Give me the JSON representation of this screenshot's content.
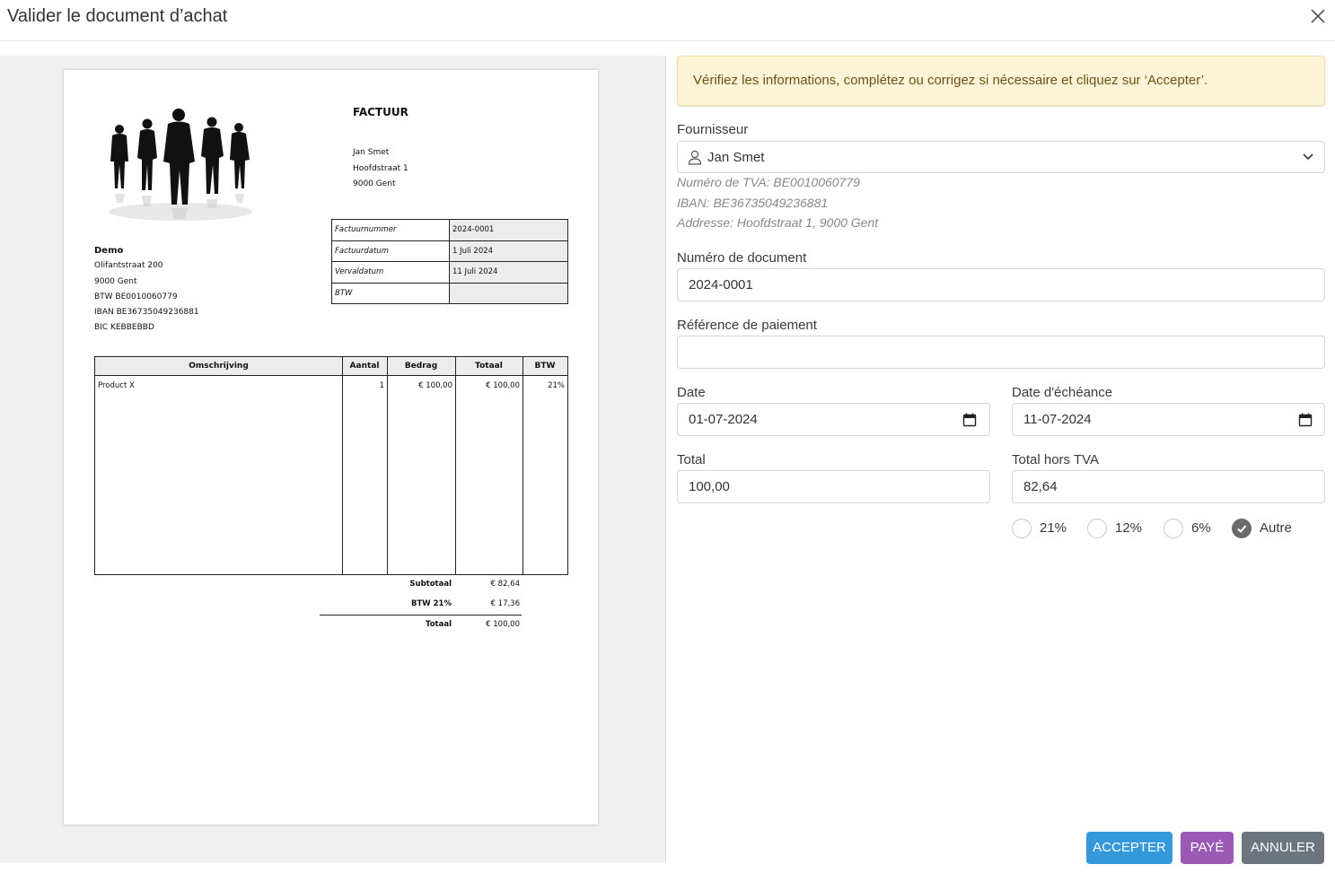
{
  "dialog": {
    "title": "Valider le document d’achat"
  },
  "invoice": {
    "title": "FACTUUR",
    "supplier": [
      "Jan Smet",
      "Hoofdstraat 1",
      "9000 Gent"
    ],
    "client": {
      "name": "Demo",
      "lines": [
        "Olifantstraat 200",
        "9000 Gent",
        "BTW BE0010060779",
        "IBAN BE36735049236881",
        "BIC KEBBEBBD"
      ]
    },
    "meta": [
      {
        "key": "Factuurnummer",
        "value": "2024-0001"
      },
      {
        "key": "Factuurdatum",
        "value": "1 Juli 2024"
      },
      {
        "key": "Vervaldatum",
        "value": "11 Juli 2024"
      },
      {
        "key": "BTW",
        "value": ""
      }
    ],
    "columns": [
      "Omschrijving",
      "Aantal",
      "Bedrag",
      "Totaal",
      "BTW"
    ],
    "rows": [
      {
        "desc": "Product X",
        "qty": "1",
        "amount": "€ 100,00",
        "total": "€ 100,00",
        "vat": "21%"
      }
    ],
    "totals": [
      {
        "label": "Subtotaal",
        "value": "€ 82,64"
      },
      {
        "label": "BTW 21%",
        "value": "€ 17,36"
      },
      {
        "label": "Totaal",
        "value": "€ 100,00"
      }
    ]
  },
  "form": {
    "banner": "Vérifiez les informations, complétez ou corrigez si nécessaire et cliquez sur ‘Accepter’.",
    "supplier": {
      "label": "Fournisseur",
      "value": "Jan Smet",
      "vat": "Numéro de TVA: BE0010060779",
      "iban": "IBAN: BE36735049236881",
      "address": "Addresse: Hoofdstraat 1, 9000 Gent"
    },
    "doc_number": {
      "label": "Numéro de document",
      "value": "2024-0001"
    },
    "payment_ref": {
      "label": "Référence de paiement",
      "value": ""
    },
    "date": {
      "label": "Date",
      "value": "01-07-2024"
    },
    "due_date": {
      "label": "Date d'échéance",
      "value": "11-07-2024"
    },
    "total": {
      "label": "Total",
      "value": "100,00"
    },
    "total_excl": {
      "label": "Total hors TVA",
      "value": "82,64"
    },
    "vat_options": [
      {
        "label": "21%",
        "selected": false
      },
      {
        "label": "12%",
        "selected": false
      },
      {
        "label": "6%",
        "selected": false
      },
      {
        "label": "Autre",
        "selected": true
      }
    ]
  },
  "buttons": {
    "accept": "ACCEPTER",
    "paid": "PAYÉ",
    "cancel": "ANNULER"
  },
  "colors": {
    "accept": "#3498db",
    "paid": "#9b59b6",
    "cancel": "#6c757d",
    "banner_bg": "#fdf3d6"
  }
}
